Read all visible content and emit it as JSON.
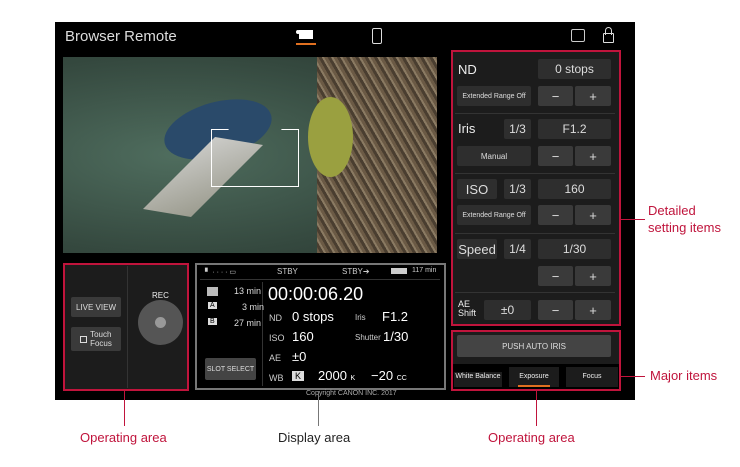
{
  "header": {
    "title": "Browser Remote",
    "camera_tab_icon": "video-camera-icon",
    "mobile_tab_icon": "phone-icon"
  },
  "left": {
    "live_view": "LIVE VIEW",
    "touch_focus_1": "Touch",
    "touch_focus_2": "Focus",
    "rec": "REC"
  },
  "display": {
    "stby1": "STBY",
    "stby2": "STBY➔",
    "battery_min": "117 min",
    "timecode": "00:00:06.20",
    "slot_int": "13 min",
    "slot_a": "3 min",
    "slot_b": "27 min",
    "slot_a_label": "A",
    "slot_b_label": "B",
    "slot_select": "SLOT SELECT",
    "nd_label": "ND",
    "nd": "0 stops",
    "iris_label": "Iris",
    "iris": "F1.2",
    "iso_label": "ISO",
    "iso": "160",
    "shutter_label": "Shutter",
    "shutter": "1/30",
    "ae_label": "AE",
    "ae": "±0",
    "wb_label": "WB",
    "wb_mode": "K",
    "wb_k": "2000",
    "wb_k_unit": "K",
    "wb_cc": "−20",
    "wb_cc_unit": "CC"
  },
  "settings": {
    "nd_label": "ND",
    "nd_value": "0 stops",
    "nd_ext": "Extended Range Off",
    "iris_label": "Iris",
    "iris_step": "1/3",
    "iris_value": "F1.2",
    "iris_mode": "Manual",
    "iso_label": "ISO",
    "iso_step": "1/3",
    "iso_value": "160",
    "iso_ext": "Extended Range Off",
    "speed_label": "Speed",
    "speed_step": "1/4",
    "speed_value": "1/30",
    "ae_label1": "AE",
    "ae_label2": "Shift",
    "ae_value": "±0",
    "minus": "−",
    "plus": "+"
  },
  "major": {
    "push_auto_iris": "PUSH AUTO IRIS",
    "tabs": [
      "White Balance",
      "Exposure",
      "Focus"
    ]
  },
  "copyright": "Copyright CANON INC. 2017",
  "annotations": {
    "operating_left": "Operating area",
    "display": "Display area",
    "operating_right": "Operating area",
    "detailed1": "Detailed",
    "detailed2": "setting items",
    "major": "Major items"
  }
}
